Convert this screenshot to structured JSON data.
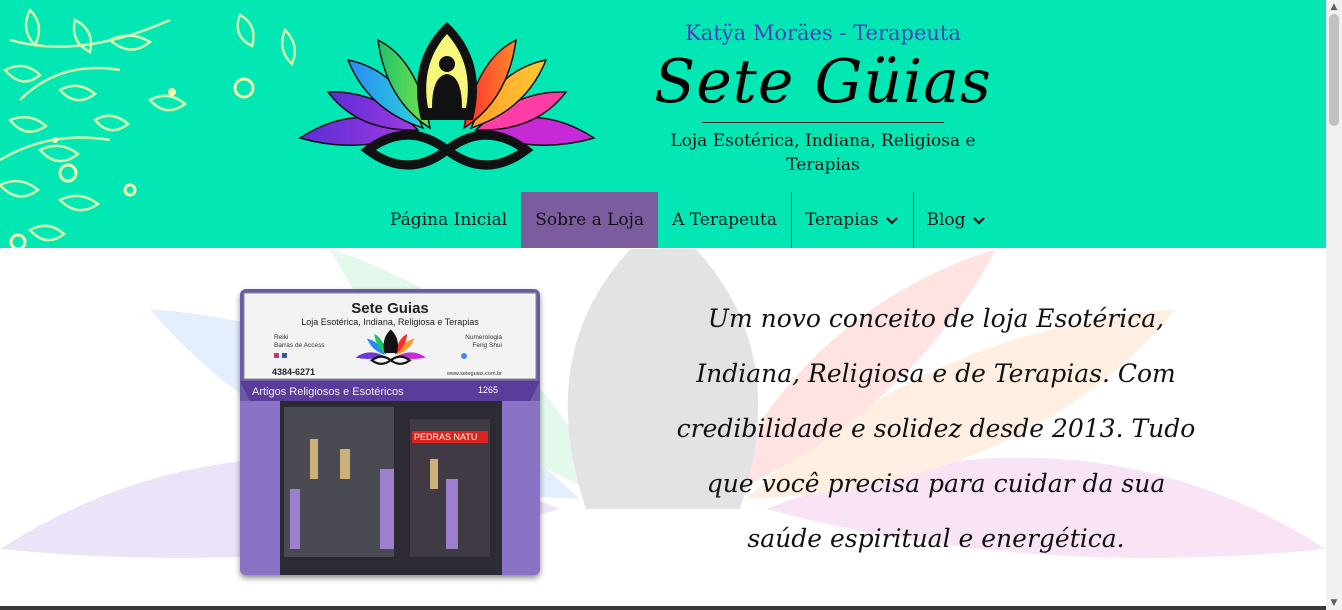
{
  "header": {
    "subtitle": "Katÿa Moräes - Terapeuta",
    "title": "Sete Güias",
    "tagline": "Loja Esotérica, Indiana, Religiosa e Terapias",
    "bg_color": "#02e7b4"
  },
  "nav": {
    "items": [
      {
        "label": "Página Inicial",
        "active": false,
        "dropdown": false
      },
      {
        "label": "Sobre a Loja",
        "active": true,
        "dropdown": false
      },
      {
        "label": "A Terapeuta",
        "active": false,
        "dropdown": false
      },
      {
        "label": "Terapias",
        "active": false,
        "dropdown": true
      },
      {
        "label": "Blog",
        "active": false,
        "dropdown": true
      }
    ],
    "active_color": "#7a5c9f"
  },
  "main": {
    "intro": "Um novo conceito de loja Esotérica, Indiana, Religiosa e de Terapias. Com credibilidade e solidez desde 2013. Tudo que você precisa para cuidar da sua saúde espiritual e energética.",
    "store_photo": {
      "sign_title": "Sete Guias",
      "sign_subtitle": "Loja Esotérica, Indiana, Religiosa e Terapias",
      "left_services": [
        "Reiki",
        "Barras de Access"
      ],
      "right_services": [
        "Numerologia",
        "Feng Shui"
      ],
      "phone": "4384-6271",
      "website": "www.seteguias.com.br",
      "awning_text": "Artigos Religiosos e Esotéricos",
      "number": "1265",
      "window_sign": "PEDRAS NATU"
    }
  },
  "icons": {
    "logo": "lotus-meditation-logo-icon",
    "chevron": "chevron-down-icon"
  }
}
